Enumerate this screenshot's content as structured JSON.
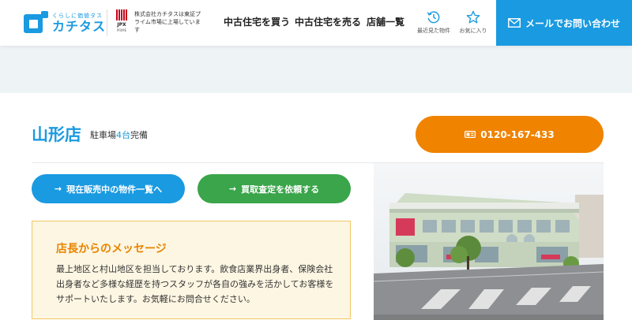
{
  "header": {
    "logo_tagline": "くらしに価値タス",
    "logo_name": "カチタス",
    "jpx_mark": "JPX",
    "jpx_sub": "PRIME",
    "listed_text": "株式会社カチタスは東証プライム市場に上場しています",
    "nav": [
      {
        "label": "中古住宅を買う"
      },
      {
        "label": "中古住宅を売る"
      },
      {
        "label": "店舗一覧"
      }
    ],
    "recent_label": "最近見た物件",
    "favorites_label": "お気に入り",
    "mail_label": "メールでお問い合わせ"
  },
  "store": {
    "name": "山形店",
    "parking_prefix": "駐車場",
    "parking_count": "4台",
    "parking_suffix": "完備",
    "phone": "0120-167-433"
  },
  "actions": {
    "listings_label": "現在販売中の物件一覧へ",
    "appraisal_label": "買取査定を依頼する"
  },
  "message": {
    "title": "店長からのメッセージ",
    "body": "最上地区と村山地区を担当しております。飲食店業界出身者、保険会社出身者など多様な経歴を持つスタッフが各自の強みを活かしてお客様をサポートいたします。お気軽にお問合せください。"
  },
  "colors": {
    "brand_blue": "#1a9ae0",
    "orange": "#f08300",
    "green": "#3aa54a",
    "message_bg": "#fdf6e3"
  },
  "icons": {
    "recent": "clock-history-icon",
    "favorites": "star-icon",
    "mail": "envelope-icon",
    "phone": "phone-icon",
    "arrow": "arrow-right-icon"
  }
}
